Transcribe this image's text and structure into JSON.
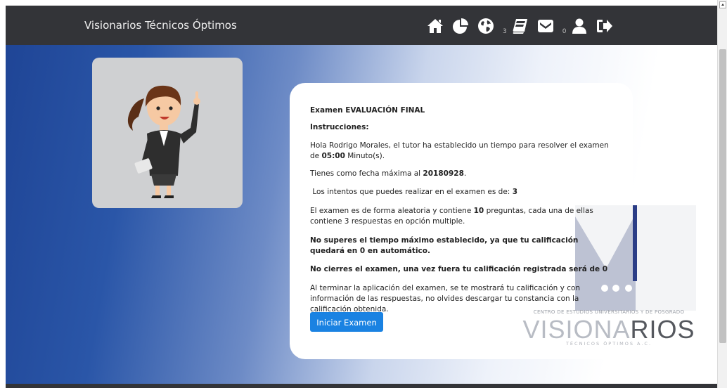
{
  "brand": "Visionarios Técnicos Óptimos",
  "nav": {
    "icons": [
      "home-icon",
      "pie-chart-icon",
      "globe-icon",
      "book-icon",
      "envelope-icon",
      "user-icon",
      "sign-out-icon"
    ],
    "globe_badge": "3",
    "envelope_badge": "0"
  },
  "exam": {
    "title": "Examen EVALUACIÓN FINAL",
    "instructions_heading": "Instrucciones:",
    "greeting_prefix": "Hola Rodrigo Morales, el tutor ha establecido un tiempo para resolver el examen de",
    "time_value": "05:00",
    "time_unit": " Minuto(s).",
    "deadline_prefix": "Tienes como fecha máxima al ",
    "deadline_value": "20180928",
    "deadline_suffix": ".",
    "attempts_prefix": " Los intentos que puedes realizar en el examen es de: ",
    "attempts_value": "3",
    "random_prefix": "El examen es de forma aleatoria y contiene ",
    "questions_value": "10",
    "random_suffix": " preguntas, cada una de ellas contiene 3 respuestas en opción multiple.",
    "warning_time": "No superes el tiempo máximo establecido, ya que tu calificación quedará en 0 en automático.",
    "warning_close": "No cierres el examen, una vez fuera tu calificación registrada será de 0",
    "closing_note": "Al terminar la aplicación del examen, se te mostrará tu calificación y con información de las respuestas, no olvides descargar tu constancia con la calificación obtenida.",
    "start_button": "Iniciar Examen"
  },
  "watermark": {
    "top_line": "CENTRO DE ESTUDIOS UNIVERSITARIOS Y DE POSGRADO",
    "big_left": "VISIONA",
    "big_right": "RIOS",
    "sub_line": "TÉCNICOS ÓPTIMOS A.C."
  },
  "colors": {
    "navbar": "#333438",
    "button": "#1a82e2",
    "hero_dark": "#1f4596"
  }
}
